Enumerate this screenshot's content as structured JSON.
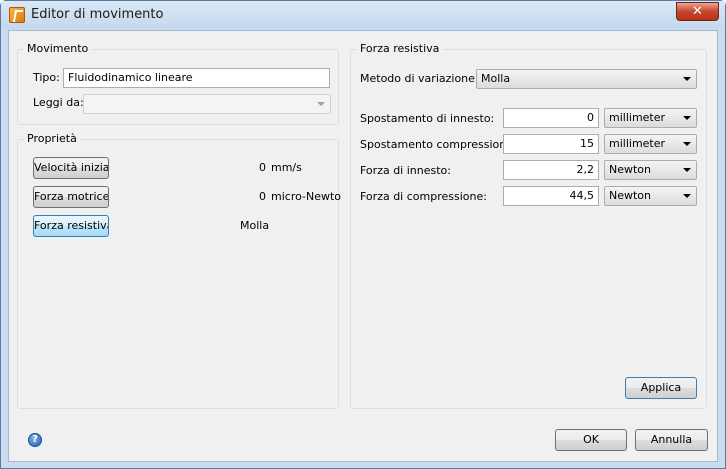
{
  "window": {
    "title": "Editor di movimento",
    "close_glyph": "✕"
  },
  "movimento": {
    "group_title": "Movimento",
    "tipo_label": "Tipo:",
    "tipo_value": "Fluidodinamico lineare",
    "leggi_label": "Leggi da:",
    "leggi_value": ""
  },
  "proprieta": {
    "group_title": "Proprietà",
    "rows": [
      {
        "button": "Velocità iniziale",
        "value": "0",
        "unit": "mm/s"
      },
      {
        "button": "Forza motrice",
        "value": "0",
        "unit": "micro-Newto"
      },
      {
        "button": "Forza resistiva",
        "value": "Molla",
        "unit": ""
      }
    ]
  },
  "forza_resistiva": {
    "group_title": "Forza resistiva",
    "metodo_label": "Metodo di variazione:",
    "metodo_value": "Molla",
    "rows": [
      {
        "label": "Spostamento di innesto:",
        "value": "0",
        "unit": "millimeter"
      },
      {
        "label": "Spostamento compressione:",
        "value": "15",
        "unit": "millimeter"
      },
      {
        "label": "Forza di innesto:",
        "value": "2,2",
        "unit": "Newton"
      },
      {
        "label": "Forza di compressione:",
        "value": "44,5",
        "unit": "Newton"
      }
    ],
    "apply_label": "Applica"
  },
  "footer": {
    "help_glyph": "?",
    "ok_label": "OK",
    "cancel_label": "Annulla"
  },
  "colors": {
    "frame": "#c9dcf0",
    "dialog_bg": "#f0f0f0",
    "close_red": "#c7462c",
    "active_blue": "#bee6fd"
  },
  "icons": [
    "app-icon",
    "close-icon",
    "help-icon",
    "chevron-down-icon"
  ]
}
